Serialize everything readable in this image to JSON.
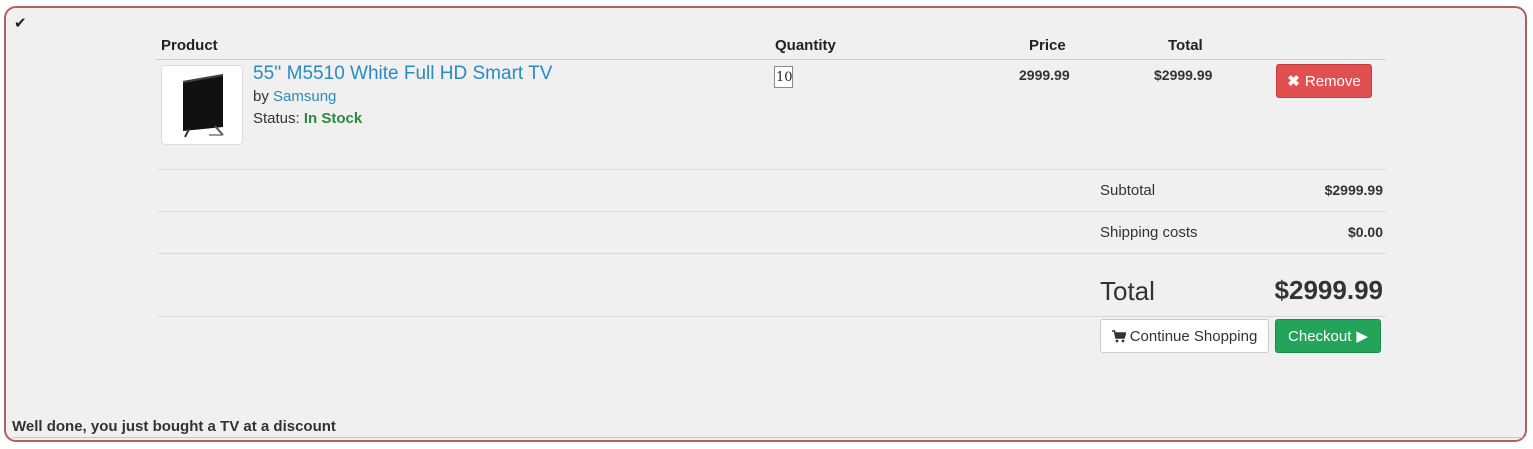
{
  "status_icon": "checkmark-icon",
  "table": {
    "headers": {
      "product": "Product",
      "quantity": "Quantity",
      "price": "Price",
      "total": "Total"
    }
  },
  "item": {
    "name": "55'' M5510 White Full HD Smart TV",
    "by_label": "by",
    "brand": "Samsung",
    "status_label": "Status:",
    "status_value": "In Stock",
    "quantity": "10",
    "price": "2999.99",
    "line_total": "$2999.99",
    "remove_icon": "times-icon",
    "remove_label": "Remove",
    "image_icon": "tv-thumbnail"
  },
  "summary": {
    "subtotal_label": "Subtotal",
    "subtotal_value": "$2999.99",
    "shipping_label": "Shipping costs",
    "shipping_value": "$0.00",
    "total_label": "Total",
    "total_value": "$2999.99"
  },
  "actions": {
    "continue_icon": "shopping-cart-icon",
    "continue_label": "Continue Shopping",
    "checkout_label": "Checkout",
    "checkout_icon": "play-icon"
  },
  "colors": {
    "link": "#2a8bc4",
    "in_stock": "#2e8a3c",
    "remove_button": "#e05050",
    "checkout_button": "#23a45a",
    "frame_border": "#b06060"
  },
  "footer": {
    "message": "Well done, you just bought a TV at a discount"
  }
}
